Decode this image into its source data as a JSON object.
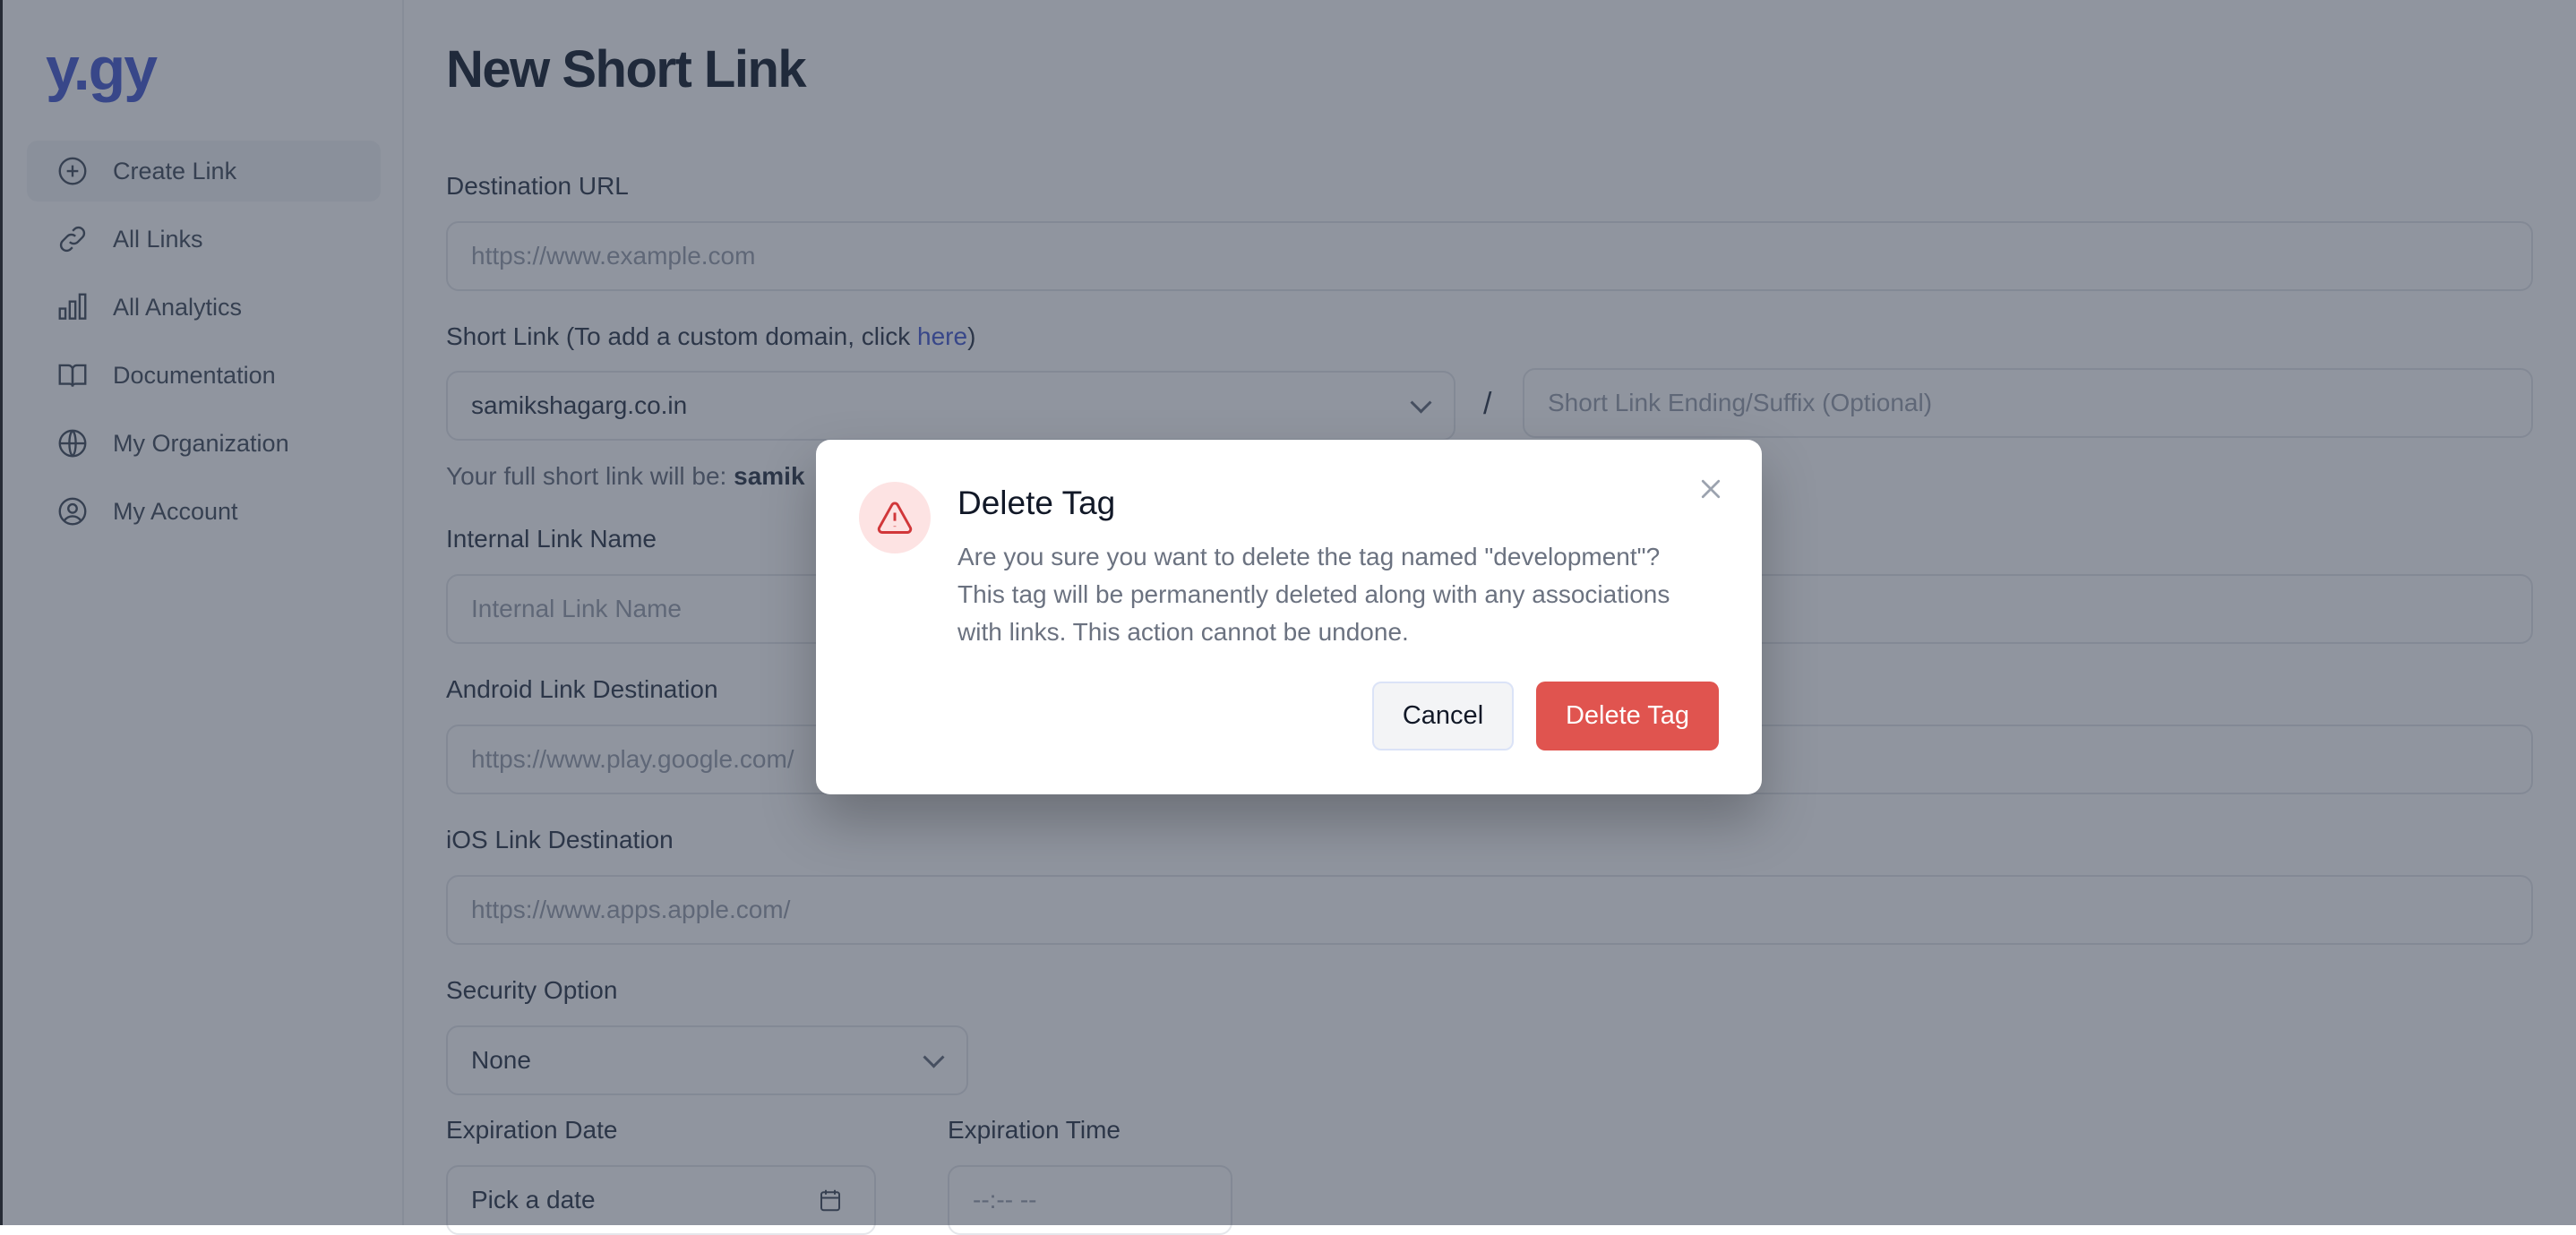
{
  "app": {
    "logo": "y.gy"
  },
  "sidebar": {
    "items": [
      {
        "label": "Create Link",
        "icon": "plus-circle-icon",
        "active": true
      },
      {
        "label": "All Links",
        "icon": "link-icon",
        "active": false
      },
      {
        "label": "All Analytics",
        "icon": "bar-chart-icon",
        "active": false
      },
      {
        "label": "Documentation",
        "icon": "book-icon",
        "active": false
      },
      {
        "label": "My Organization",
        "icon": "globe-icon",
        "active": false
      },
      {
        "label": "My Account",
        "icon": "user-circle-icon",
        "active": false
      }
    ]
  },
  "main": {
    "title": "New Short Link",
    "destination": {
      "label": "Destination URL",
      "placeholder": "https://www.example.com"
    },
    "short_link": {
      "label_prefix": "Short Link (To add a custom domain, click ",
      "label_link": "here",
      "label_suffix": ")",
      "domain_value": "samikshagarg.co.in",
      "separator": "/",
      "suffix_placeholder": "Short Link Ending/Suffix (Optional)",
      "full_link_prefix": "Your full short link will be: ",
      "full_link_value": "samik"
    },
    "internal_name": {
      "label": "Internal Link Name",
      "placeholder": "Internal Link Name"
    },
    "android": {
      "label": "Android Link Destination",
      "placeholder": "https://www.play.google.com/"
    },
    "ios": {
      "label": "iOS Link Destination",
      "placeholder": "https://www.apps.apple.com/"
    },
    "security": {
      "label": "Security Option",
      "value": "None"
    },
    "expiration_date": {
      "label": "Expiration Date",
      "placeholder": "Pick a date"
    },
    "expiration_time": {
      "label": "Expiration Time",
      "placeholder": "--:-- --"
    }
  },
  "modal": {
    "title": "Delete Tag",
    "body": "Are you sure you want to delete the tag named \"development\"? This tag will be permanently deleted along with any associations with links. This action cannot be undone.",
    "cancel_label": "Cancel",
    "confirm_label": "Delete Tag",
    "icon": "warning-triangle-icon",
    "colors": {
      "danger": "#e0544f",
      "danger_bg": "#fde3e3",
      "accent": "#4f63d2"
    }
  }
}
